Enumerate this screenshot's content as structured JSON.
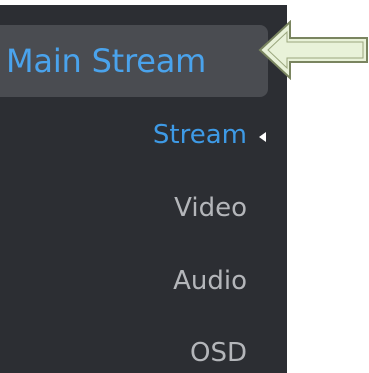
{
  "menu": {
    "group_label": "Main Stream",
    "items": [
      {
        "label": "Stream",
        "active": true
      },
      {
        "label": "Video",
        "active": false
      },
      {
        "label": "Audio",
        "active": false
      },
      {
        "label": "OSD",
        "active": false
      }
    ]
  },
  "icons": {
    "active_marker": "caret-left-icon",
    "annotation": "left-arrow-icon"
  },
  "colors": {
    "panel_bg": "#2c2e33",
    "group_bg": "#4a4c51",
    "accent": "#3e9ae6",
    "text_muted": "#b4b6ba",
    "arrow_fill": "#e9f2d9",
    "arrow_stroke": "#7a8560"
  }
}
